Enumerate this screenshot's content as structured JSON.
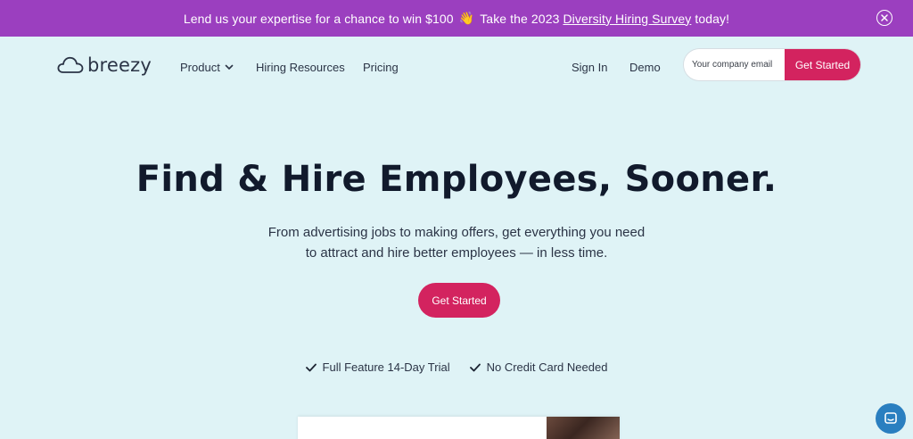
{
  "banner": {
    "text_before": "Lend us your expertise for a chance to win $100",
    "emoji": "👋",
    "text_mid": "Take the 2023",
    "link_text": "Diversity Hiring Survey",
    "text_after": "today!",
    "close_icon": "close-circle-icon"
  },
  "nav": {
    "logo_text": "breezy",
    "logo_icon": "cloud-icon",
    "items": [
      {
        "label": "Product",
        "has_dropdown": true
      },
      {
        "label": "Hiring Resources"
      },
      {
        "label": "Pricing"
      },
      {
        "label": "Sign In"
      },
      {
        "label": "Demo"
      }
    ],
    "email_placeholder": "Your company email",
    "cta_label": "Get Started"
  },
  "hero": {
    "title": "Find & Hire Employees, Sooner.",
    "subtitle_line1": "From advertising jobs to making offers, get everything you need",
    "subtitle_line2": "to attract and hire better employees — in less time.",
    "cta_label": "Get Started",
    "features": [
      {
        "label": "Full Feature 14-Day Trial",
        "icon": "check-icon"
      },
      {
        "label": "No Credit Card Needed",
        "icon": "check-icon"
      }
    ]
  },
  "chat": {
    "icon": "chat-icon"
  },
  "colors": {
    "banner_bg": "#9b3fbf",
    "page_bg": "#dff3f6",
    "accent": "#d3235f",
    "text_dark": "#111a2c",
    "chat_bg": "#2a7fc0"
  }
}
